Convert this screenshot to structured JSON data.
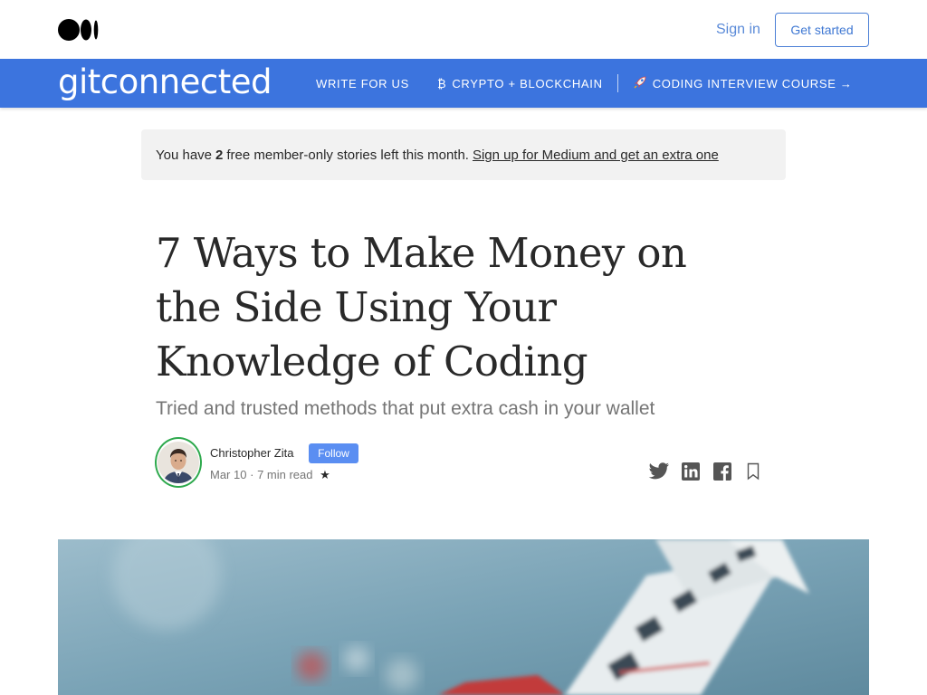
{
  "header": {
    "logo_icon": "medium-logo-icon",
    "signin_label": "Sign in",
    "getstarted_label": "Get started"
  },
  "publication": {
    "name": "gitconnected",
    "nav": [
      {
        "label": "WRITE FOR US",
        "icon": ""
      },
      {
        "label": "CRYPTO + BLOCKCHAIN",
        "icon": "₿"
      },
      {
        "label": "CODING INTERVIEW COURSE →",
        "icon": "rocket-icon"
      }
    ],
    "color": "#3c74de"
  },
  "banner": {
    "prefix": "You have",
    "count": "2",
    "suffix": "free member-only stories left this month.",
    "link": "Sign up for Medium and get an extra one"
  },
  "article": {
    "title": "7 Ways to Make Money on the Side Using Your Knowledge of Coding",
    "subtitle": "Tried and trusted methods that put extra cash in your wallet",
    "author": "Christopher Zita",
    "follow_label": "Follow",
    "date": "Mar 10",
    "separator": "·",
    "read_time": "7 min read",
    "star": "★"
  },
  "share_icons": [
    "twitter-icon",
    "linkedin-icon",
    "facebook-icon",
    "bookmark-icon"
  ]
}
